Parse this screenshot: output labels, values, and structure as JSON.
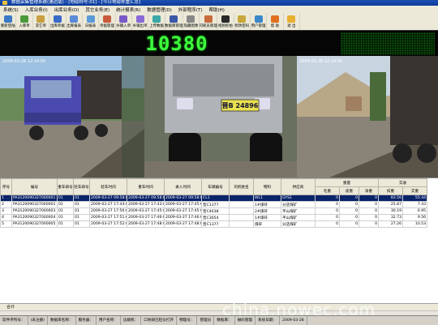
{
  "window": {
    "title": "数据采集管理系统(通达版) - [地磅称号:01] - [今日地磅称重汇总]"
  },
  "menu": [
    "系统(S)",
    "入库业务(I)",
    "出库业务(O)",
    "其它业务(E)",
    "统计报表(R)",
    "数据管理(D)",
    "外部程序(T)",
    "帮助(H)"
  ],
  "toolbar": [
    {
      "label": "重新登陆",
      "icon": "relogin-icon",
      "color": "#3a78c8"
    },
    {
      "label": "入库单",
      "icon": "inbound-icon",
      "color": "#4a9a3a"
    },
    {
      "label": "其它单",
      "icon": "other-form-icon",
      "color": "#c8a040"
    },
    {
      "label": "出库单据",
      "icon": "outbound-icon",
      "color": "#3a6ac8"
    },
    {
      "label": "出库报表",
      "icon": "outbound-report-icon",
      "color": "#5a8ad8"
    },
    {
      "label": "日报表",
      "icon": "daily-report-icon",
      "color": "#5a9ad8"
    },
    {
      "label": "单据管理",
      "icon": "form-manage-icon",
      "color": "#c85a3a"
    },
    {
      "label": "补输入单",
      "icon": "supplement-icon",
      "color": "#7a5ac8"
    },
    {
      "label": "补输出单",
      "icon": "supplement-out-icon",
      "color": "#8a6ad8"
    },
    {
      "label": "上传数据",
      "icon": "upload-icon",
      "color": "#3aa8a8"
    },
    {
      "label": "数据库管理",
      "icon": "database-icon",
      "color": "#3a58a8"
    },
    {
      "label": "隐藏图像",
      "icon": "hide-image-icon",
      "color": "#888888"
    },
    {
      "label": "司磅员管理",
      "icon": "operator-icon",
      "color": "#c86a3a"
    },
    {
      "label": "视频抓拍",
      "icon": "camera-icon",
      "color": "#2a2a2a"
    },
    {
      "label": "修改密码",
      "icon": "password-icon",
      "color": "#c8a83a"
    },
    {
      "label": "用户管理",
      "icon": "user-icon",
      "color": "#3a88c8"
    },
    {
      "label": "帮 助",
      "icon": "help-icon",
      "color": "#e07020"
    },
    {
      "label": "退 出",
      "icon": "exit-icon",
      "color": "#e8b030"
    }
  ],
  "weight_display": "10380",
  "cameras": [
    {
      "timestamp": "2009-03-28 12:14:05"
    },
    {
      "timestamp": ""
    },
    {
      "timestamp": "2009-03-28 12:14:05"
    }
  ],
  "plate": "晋B 24896",
  "table": {
    "headers": [
      "序号",
      "编号",
      "重车磅号",
      "轻车磅号",
      "轻车时间",
      "重车时间",
      "录入时间",
      "车辆编号",
      "司机姓名",
      "物料",
      "供应商",
      "毛重",
      "皮重",
      "净重",
      "扣重",
      "实重"
    ],
    "group_headers": {
      "weight": "重量",
      "settle": "实收"
    },
    "rows": [
      [
        "1",
        "PA3120090327000001",
        "01",
        "01",
        "2009-03-27 09:58:00",
        "2009-03-27 09:58:00",
        "2009-03-27 09:58:00",
        "CL1",
        "",
        "WL1",
        "GYS1",
        "0",
        "0",
        "0",
        "83.56",
        "55.44"
      ],
      [
        "2",
        "PA3120090327000002",
        "01",
        "01",
        "2009-03-27 17:44:00",
        "2009-03-27 17:43:00",
        "2009-03-27 17:45:00",
        "晋C1377",
        "",
        "1#煤矸",
        "分店煤矿",
        "0",
        "0",
        "0",
        "25.87",
        "7.43"
      ],
      [
        "3",
        "PA3120090327000003",
        "01",
        "01",
        "2009-03-27 17:56:00",
        "2009-03-27 17:45:00",
        "2009-03-27 17:45:00",
        "晋C4638",
        "",
        "2#煤矸",
        "平山煤矿",
        "0",
        "0",
        "0",
        "30.19",
        "6.95"
      ],
      [
        "4",
        "PA3120090327000004",
        "01",
        "01",
        "2009-03-27 17:51:00",
        "2009-03-27 17:46:00",
        "2009-03-27 17:46:00",
        "晋C3654",
        "",
        "1#煤矸",
        "平山煤矿",
        "0",
        "0",
        "0",
        "32.73",
        "9.56"
      ],
      [
        "5",
        "PA3120090327000005",
        "01",
        "01",
        "2009-03-27 17:52:00",
        "2009-03-27 17:48:00",
        "2009-03-27 17:48:00",
        "晋C1377",
        "",
        "煤矸",
        "分店煤矿",
        "0",
        "0",
        "0",
        "27.26",
        "10.53"
      ]
    ]
  },
  "summary_label": "合计",
  "status": [
    "软件序列号：",
    "(未注册)",
    "数据库名称：",
    "服务器：",
    "用户名称：",
    "远端机：",
    "口地磅已检仪打开",
    "物理号：",
    "管理员",
    "数据库：",
    "磁码管理",
    "系统日期：",
    "2009-03-28"
  ],
  "watermark": "china.nowec.com"
}
